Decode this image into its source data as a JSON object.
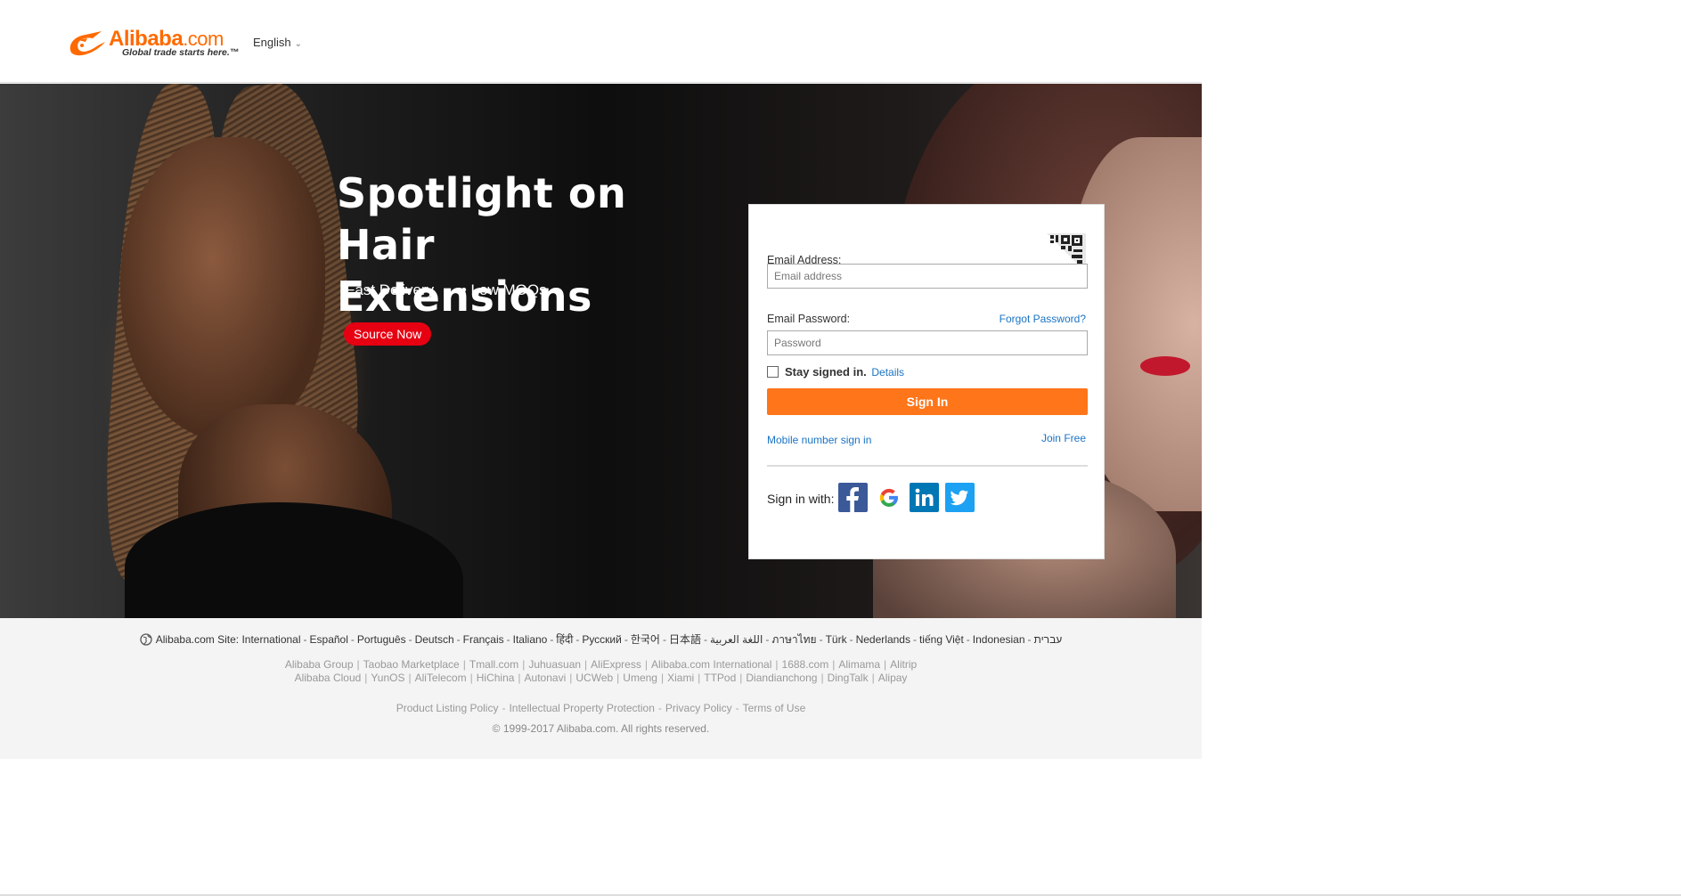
{
  "header": {
    "logo_word": "Alibaba",
    "logo_dotcom": ".com",
    "logo_tagline": "Global trade starts here.™",
    "language": "English"
  },
  "hero": {
    "title_line1": "Spotlight on",
    "title_line2": "Hair Extensions",
    "bullet1": "•Fast Delivery",
    "bullet2": "• Low MOQs",
    "cta_label": "Source Now"
  },
  "login": {
    "email_label": "Email Address:",
    "email_placeholder": "Email address",
    "email_value": "",
    "password_label": "Email Password:",
    "password_placeholder": "Password",
    "forgot_label": "Forgot Password?",
    "stay_label": "Stay signed in.",
    "details_label": "Details",
    "sign_in_label": "Sign In",
    "mobile_label": "Mobile number sign in",
    "join_label": "Join Free",
    "sign_in_with_label": "Sign in with:",
    "social": [
      {
        "name": "facebook",
        "color": "#3b5998"
      },
      {
        "name": "google",
        "color": "#ffffff"
      },
      {
        "name": "linkedin",
        "color": "#0077b5"
      },
      {
        "name": "twitter",
        "color": "#1da1f2"
      }
    ]
  },
  "footer": {
    "site_label": "Alibaba.com Site:",
    "sites": [
      "International",
      "Español",
      "Português",
      "Deutsch",
      "Français",
      "Italiano",
      "हिंदी",
      "Pусский",
      "한국어",
      "日本語",
      "اللغة العربية",
      "ภาษาไทย",
      "Türk",
      "Nederlands",
      "tiếng Việt",
      "Indonesian",
      "עברית"
    ],
    "group_row1": [
      "Alibaba Group",
      "Taobao Marketplace",
      "Tmall.com",
      "Juhuasuan",
      "AliExpress",
      "Alibaba.com International",
      "1688.com",
      "Alimama",
      "Alitrip"
    ],
    "group_row2": [
      "Alibaba Cloud",
      "YunOS",
      "AliTelecom",
      "HiChina",
      "Autonavi",
      "UCWeb",
      "Umeng",
      "Xiami",
      "TTPod",
      "Diandianchong",
      "DingTalk",
      "Alipay"
    ],
    "policy_links": [
      "Product Listing Policy",
      "Intellectual Property Protection",
      "Privacy Policy",
      "Terms of Use"
    ],
    "copyright": "© 1999-2017 Alibaba.com. All rights reserved."
  },
  "colors": {
    "brand_orange": "#ff6a00",
    "sign_in_button": "#ff7519",
    "cta_red": "#e60012",
    "link_blue": "#1a73c4"
  }
}
